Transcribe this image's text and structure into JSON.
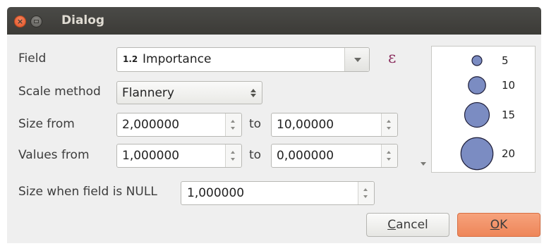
{
  "window": {
    "title": "Dialog"
  },
  "field": {
    "label": "Field",
    "type_prefix": "1.2",
    "value": "Importance",
    "expr_symbol": "ε"
  },
  "scale_method": {
    "label": "Scale method",
    "value": "Flannery"
  },
  "size_from": {
    "label": "Size from",
    "from_value": "2,000000",
    "to_label": "to",
    "to_value": "10,00000"
  },
  "values_from": {
    "label": "Values from",
    "from_value": "1,000000",
    "to_label": "to",
    "to_value": "0,000000"
  },
  "null_size": {
    "label": "Size when field is NULL",
    "value": "1,000000"
  },
  "legend": {
    "items": [
      {
        "label": "5",
        "size": 5
      },
      {
        "label": "10",
        "size": 10
      },
      {
        "label": "15",
        "size": 15
      },
      {
        "label": "20",
        "size": 20
      }
    ],
    "fill": "#7b8cc2",
    "stroke": "#1f1f3a"
  },
  "buttons": {
    "cancel": "Cancel",
    "cancel_mnemonic": "C",
    "cancel_rest": "ancel",
    "ok": "OK",
    "ok_mnemonic": "O",
    "ok_rest": "K"
  },
  "colors": {
    "titlebar": "#3c3b37",
    "ok_button": "#ee8659",
    "close_button": "#e0562a"
  }
}
